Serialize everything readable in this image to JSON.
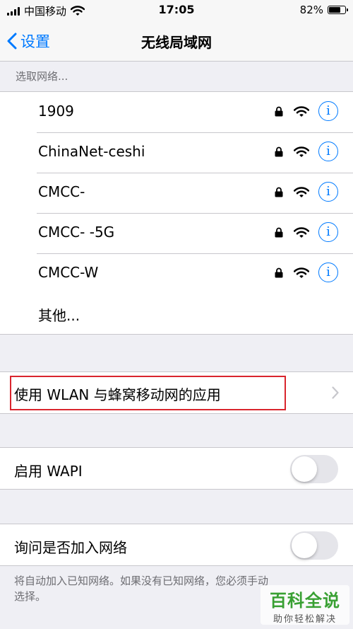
{
  "status_bar": {
    "carrier": "中国移动",
    "time": "17:05",
    "battery": "82%",
    "battery_level": 0.82
  },
  "nav": {
    "back_label": "设置",
    "title": "无线局域网"
  },
  "section_header": "选取网络...",
  "networks": [
    {
      "name": "1909",
      "locked": true
    },
    {
      "name": "ChinaNet-ceshi",
      "locked": true
    },
    {
      "name": "CMCC-",
      "locked": true
    },
    {
      "name": "CMCC-  -5G",
      "locked": true
    },
    {
      "name": "CMCC-W",
      "locked": true
    }
  ],
  "other_label": "其他...",
  "wlan_apps_label": "使用 WLAN 与蜂窝移动网的应用",
  "wapi": {
    "label": "启用 WAPI",
    "on": false
  },
  "ask_join": {
    "label": "询问是否加入网络",
    "on": false
  },
  "footer_note": "将自动加入已知网络。如果没有已知网络，您必须手动选择。",
  "watermark": {
    "title": "百科全说",
    "subtitle": "助你轻松解决"
  },
  "colors": {
    "accent": "#007aff",
    "highlight_box": "#d9252d",
    "background": "#efeff4"
  }
}
